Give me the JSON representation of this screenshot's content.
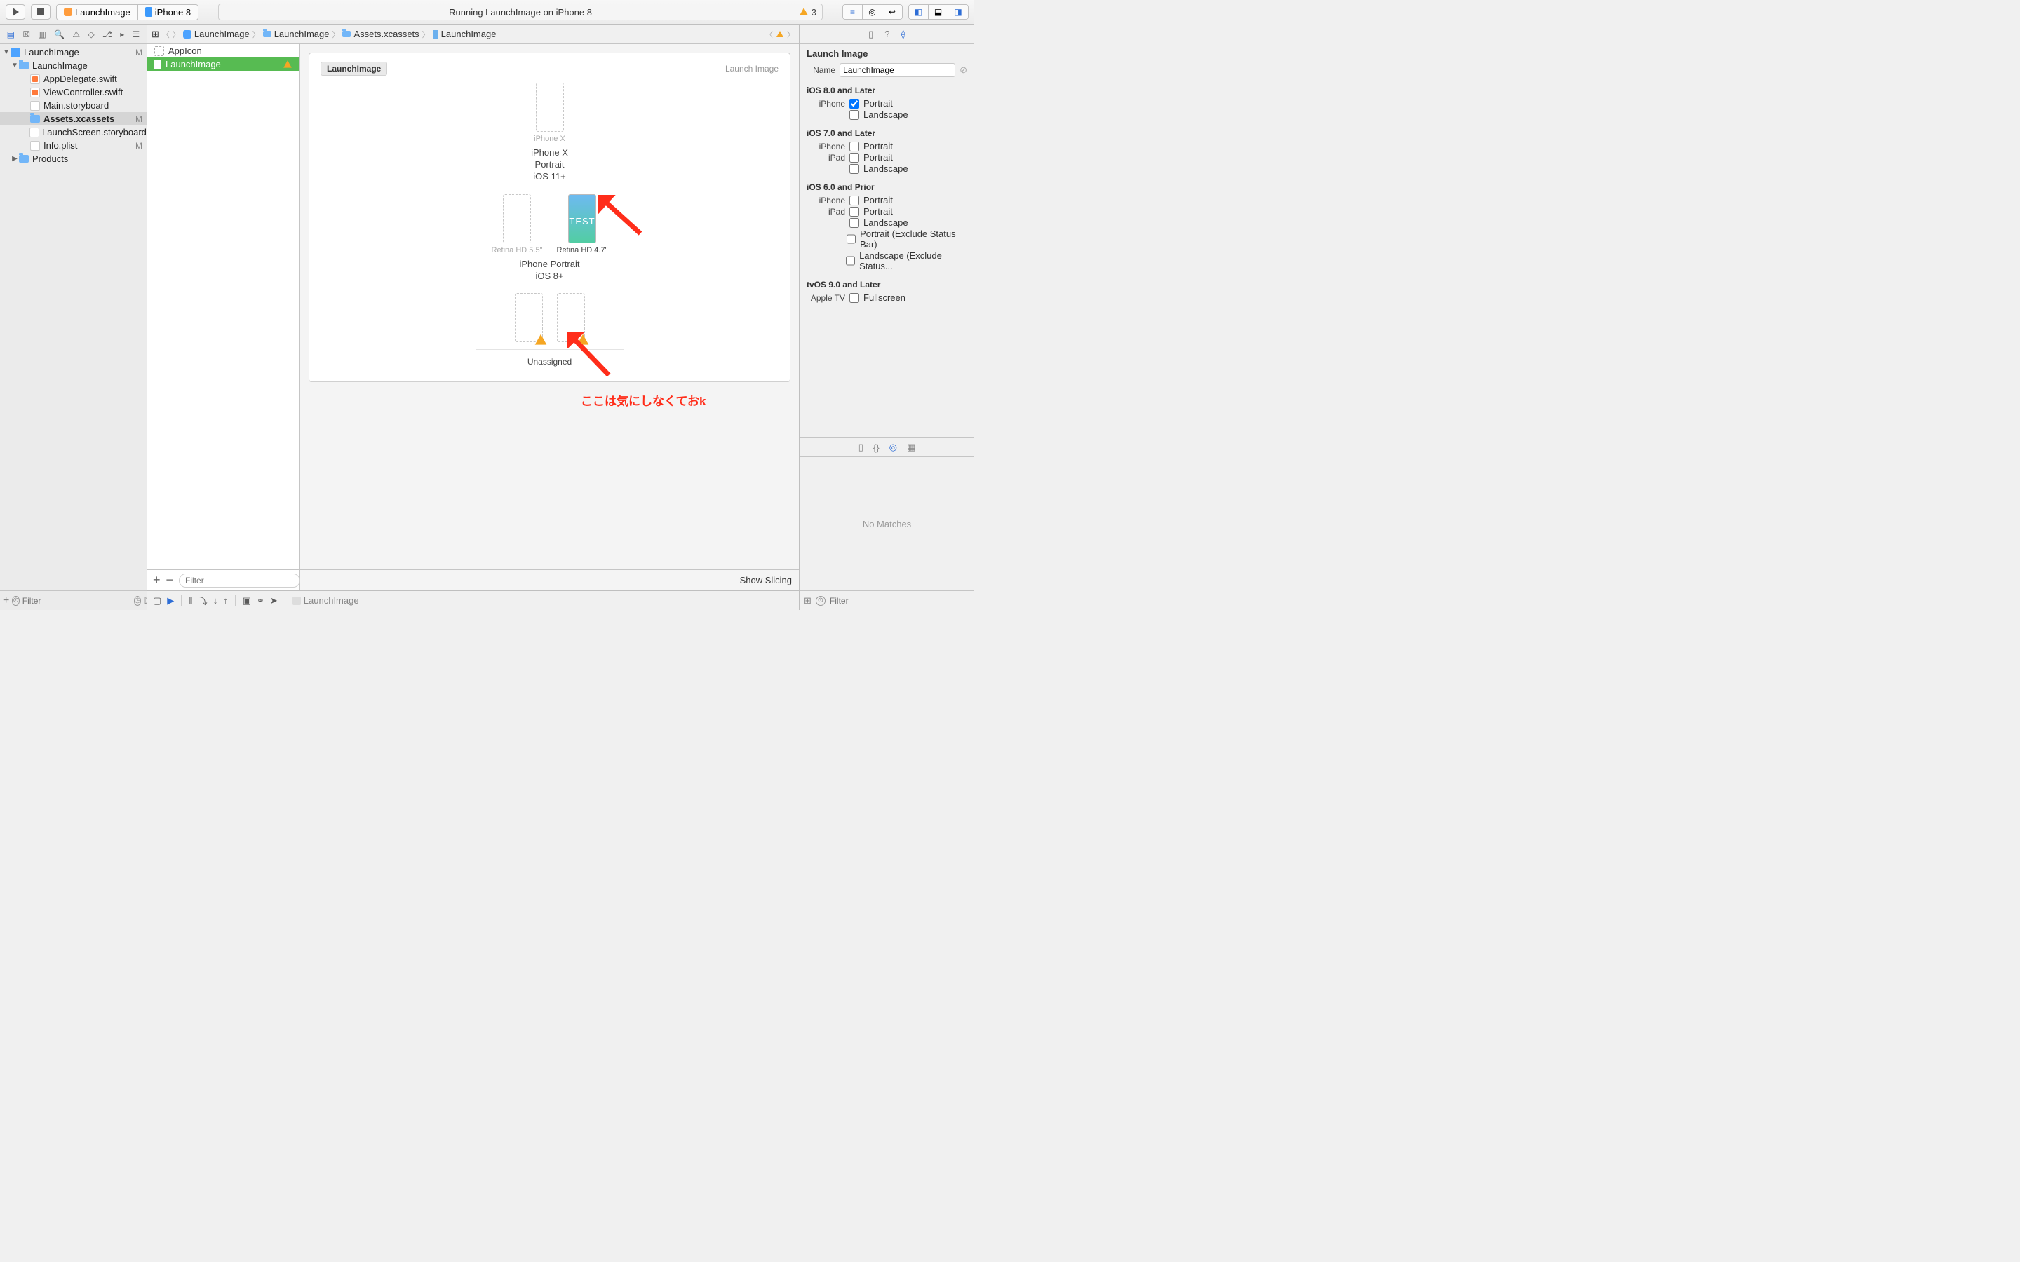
{
  "toolbar": {
    "scheme": "LaunchImage",
    "destination": "iPhone 8",
    "status": "Running LaunchImage on iPhone 8",
    "warning_count": "3"
  },
  "navigator": {
    "filter_placeholder": "Filter",
    "tree": {
      "project": "LaunchImage",
      "project_badge": "M",
      "group": "LaunchImage",
      "files": {
        "appdelegate": "AppDelegate.swift",
        "viewcontroller": "ViewController.swift",
        "mainsb": "Main.storyboard",
        "assets": "Assets.xcassets",
        "assets_badge": "M",
        "launchscreen": "LaunchScreen.storyboard",
        "plist": "Info.plist",
        "plist_badge": "M"
      },
      "products": "Products"
    }
  },
  "jumpbar": {
    "a": "LaunchImage",
    "b": "LaunchImage",
    "c": "Assets.xcassets",
    "d": "LaunchImage"
  },
  "outline": {
    "appicon": "AppIcon",
    "launchimage": "LaunchImage",
    "filter_placeholder": "Filter"
  },
  "canvas": {
    "card_title": "LaunchImage",
    "card_type": "Launch Image",
    "iphoneX_slot": "iPhone X",
    "iphoneX_group_l1": "iPhone X",
    "iphoneX_group_l2": "Portrait",
    "iphoneX_group_l3": "iOS 11+",
    "retina55": "Retina HD 5.5\"",
    "retina47": "Retina HD 4.7\"",
    "retina47_fill": "TEST",
    "ios8_group_l1": "iPhone Portrait",
    "ios8_group_l2": "iOS 8+",
    "unassigned": "Unassigned",
    "show_slicing": "Show Slicing"
  },
  "annotation": {
    "text": "ここは気にしなくておk"
  },
  "debugbar": {
    "project": "LaunchImage"
  },
  "inspector": {
    "header": "Launch Image",
    "name_label": "Name",
    "name_value": "LaunchImage",
    "sections": {
      "ios8": {
        "title": "iOS 8.0 and Later",
        "iphone": "iPhone",
        "portrait": "Portrait",
        "landscape": "Landscape"
      },
      "ios7": {
        "title": "iOS 7.0 and Later",
        "iphone": "iPhone",
        "ipad": "iPad",
        "portrait": "Portrait",
        "landscape": "Landscape"
      },
      "ios6": {
        "title": "iOS 6.0 and Prior",
        "iphone": "iPhone",
        "ipad": "iPad",
        "portrait": "Portrait",
        "landscape": "Landscape",
        "portrait_excl": "Portrait (Exclude Status Bar)",
        "landscape_excl": "Landscape (Exclude Status..."
      },
      "tvos": {
        "title": "tvOS 9.0 and Later",
        "appletv": "Apple TV",
        "fullscreen": "Fullscreen"
      }
    },
    "no_matches": "No Matches",
    "filter_placeholder": "Filter"
  }
}
